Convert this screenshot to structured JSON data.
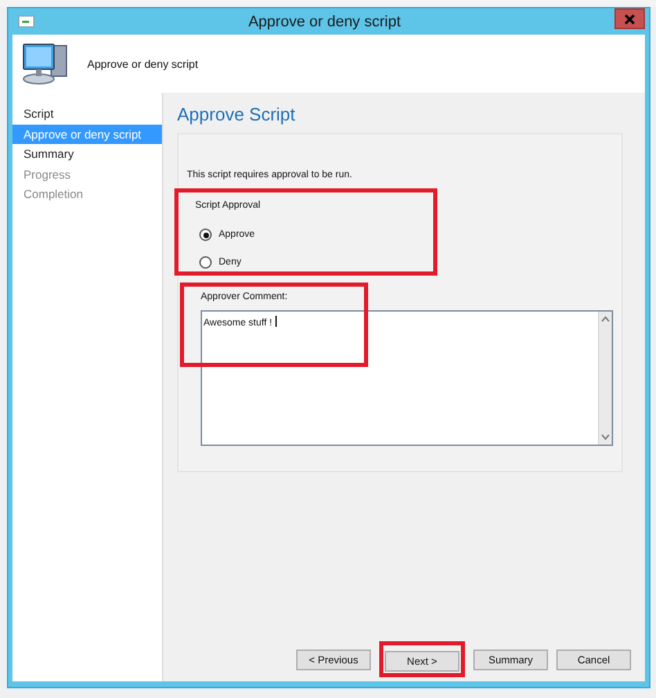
{
  "window": {
    "title": "Approve or deny script"
  },
  "header": {
    "title": "Approve or deny script"
  },
  "nav": {
    "items": [
      {
        "label": "Script",
        "selected": false,
        "disabled": false
      },
      {
        "label": "Approve or deny script",
        "selected": true,
        "disabled": false
      },
      {
        "label": "Summary",
        "selected": false,
        "disabled": false
      },
      {
        "label": "Progress",
        "selected": false,
        "disabled": true
      },
      {
        "label": "Completion",
        "selected": false,
        "disabled": true
      }
    ]
  },
  "page": {
    "heading": "Approve Script",
    "description": "This script requires approval to be run.",
    "approval_group": {
      "label": "Script Approval",
      "highlighted": true,
      "options": [
        {
          "label": "Approve",
          "selected": true
        },
        {
          "label": "Deny",
          "selected": false
        }
      ]
    },
    "comment": {
      "label": "Approver Comment:",
      "value": "Awesome stuff !",
      "highlighted": true
    }
  },
  "buttons": [
    {
      "label": "< Previous",
      "highlighted": false
    },
    {
      "label": "Next >",
      "highlighted": true
    },
    {
      "label": "Summary",
      "highlighted": false
    },
    {
      "label": "Cancel",
      "highlighted": false
    }
  ]
}
